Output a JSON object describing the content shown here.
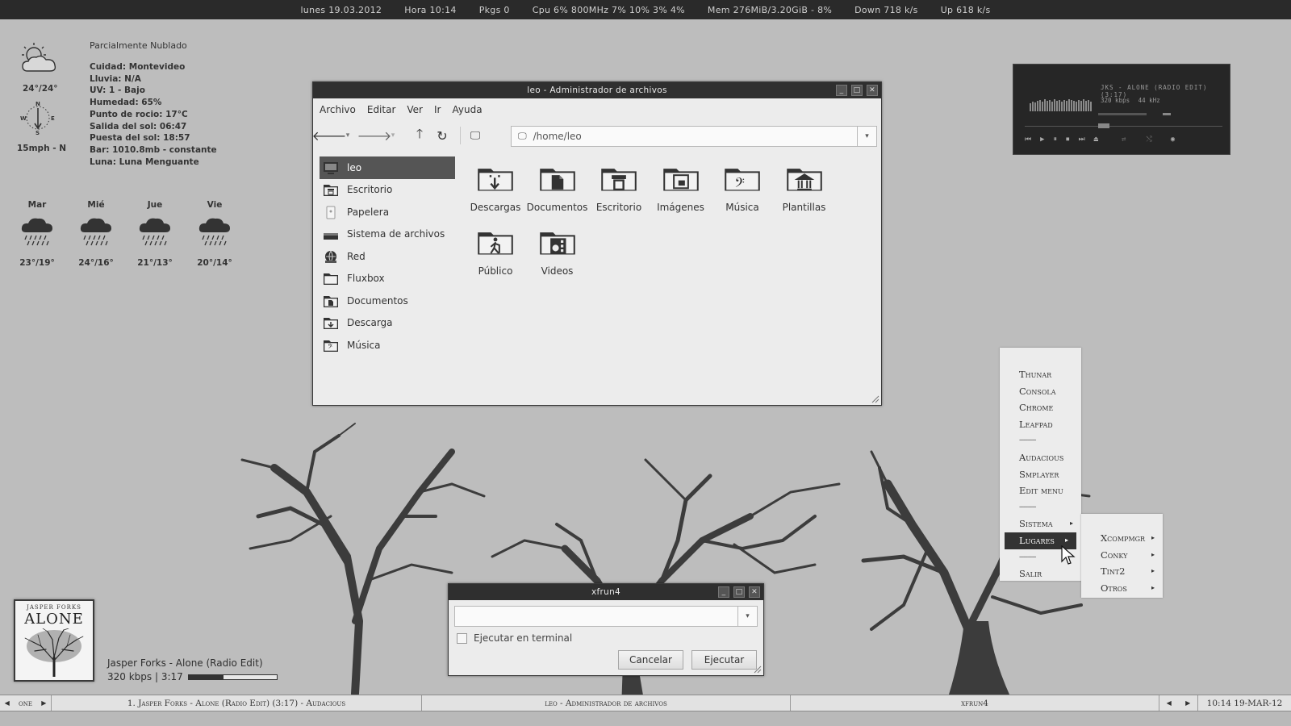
{
  "topbar": {
    "date": "lunes 19.03.2012",
    "time": "Hora 10:14",
    "pkgs": "Pkgs 0",
    "cpu": "Cpu 6%  800MHz  7% 10% 3%  4%",
    "mem": "Mem 276MiB/3.20GiB - 8%",
    "down": "Down 718  k/s",
    "up": "Up 618  k/s"
  },
  "weather": {
    "condition": "Parcialmente Nublado",
    "temp": "24°/24°",
    "wind": "15mph - N",
    "compass": {
      "n": "N",
      "w": "W",
      "e": "E",
      "s": "S"
    },
    "details": [
      "Cuidad: Montevideo",
      "Lluvia: N/A",
      "UV: 1 - Bajo",
      "Humedad: 65%",
      "Punto de rocio: 17°C",
      "Salida del sol: 06:47",
      "Puesta del sol:  18:57",
      "Bar: 1010.8mb - constante",
      "Luna: Luna Menguante"
    ],
    "forecast": [
      {
        "day": "Mar",
        "range": "23°/19°"
      },
      {
        "day": "Mié",
        "range": "24°/16°"
      },
      {
        "day": "Jue",
        "range": "21°/13°"
      },
      {
        "day": "Vie",
        "range": "20°/14°"
      }
    ]
  },
  "filemanager": {
    "title": "leo - Administrador de archivos",
    "menu": [
      "Archivo",
      "Editar",
      "Ver",
      "Ir",
      "Ayuda"
    ],
    "path": "/home/leo",
    "sidebar": [
      {
        "label": "leo",
        "icon": "computer-icon",
        "selected": true
      },
      {
        "label": "Escritorio",
        "icon": "desktop-folder-icon"
      },
      {
        "label": "Papelera",
        "icon": "trash-icon"
      },
      {
        "label": "Sistema de archivos",
        "icon": "drive-icon"
      },
      {
        "label": "Red",
        "icon": "network-icon"
      },
      {
        "label": "Fluxbox",
        "icon": "folder-icon"
      },
      {
        "label": "Documentos",
        "icon": "documents-folder-icon"
      },
      {
        "label": "Descarga",
        "icon": "downloads-folder-icon"
      },
      {
        "label": "Música",
        "icon": "music-folder-icon"
      }
    ],
    "items": [
      {
        "label": "Descargas",
        "icon": "downloads-folder-icon"
      },
      {
        "label": "Documentos",
        "icon": "documents-folder-icon"
      },
      {
        "label": "Escritorio",
        "icon": "desktop-folder-icon"
      },
      {
        "label": "Imágenes",
        "icon": "pictures-folder-icon"
      },
      {
        "label": "Música",
        "icon": "music-folder-icon"
      },
      {
        "label": "Plantillas",
        "icon": "templates-folder-icon"
      },
      {
        "label": "Público",
        "icon": "public-folder-icon"
      },
      {
        "label": "Videos",
        "icon": "videos-folder-icon"
      }
    ]
  },
  "player": {
    "track": "JKS - ALONE (RADIO EDIT) (3:17)",
    "bitrate": "320 kbps",
    "rate": "44 kHz"
  },
  "menu": {
    "items": [
      "Thunar",
      "Consola",
      "Chrome",
      "Leafpad",
      "----------",
      "Audacious",
      "Smplayer",
      "Edit menu",
      "----------",
      "Sistema",
      "Lugares",
      "----------",
      "Salir"
    ],
    "submenu_items": [
      "Xcompmgr",
      "Conky",
      "Tint2",
      "Otros"
    ],
    "active": "Lugares"
  },
  "xfrun": {
    "title": "xfrun4",
    "checkbox_label": "Ejecutar en terminal",
    "cancel": "Cancelar",
    "run": "Ejecutar"
  },
  "nowplaying": {
    "cover_artist": "JASPER FORKS",
    "cover_title": "ALONE",
    "title": "Jasper Forks - Alone (Radio Edit)",
    "info": "320 kbps | 3:17",
    "progress": 0.4
  },
  "taskbar": {
    "workspace": "one",
    "tasks": [
      "1. Jasper Forks - Alone (Radio Edit) (3:17) - Audacious",
      "leo - Administrador de archivos",
      "xfrun4"
    ],
    "clock": "10:14 19-MAR-12"
  },
  "colors": {
    "accent": "#333333",
    "panel": "#2a2a2a",
    "desktop": "#bdbdbd"
  }
}
